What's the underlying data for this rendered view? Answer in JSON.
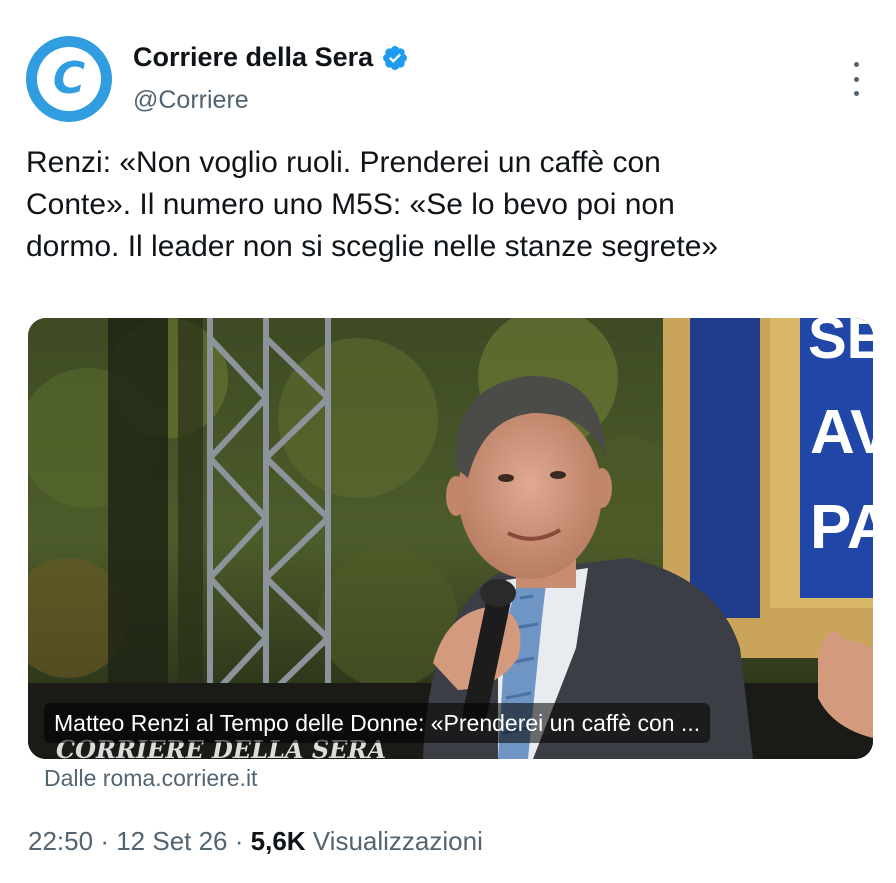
{
  "tweet": {
    "display_name": "Corriere della Sera",
    "handle": "@Corriere",
    "avatar_letter": "C",
    "verified_icon": "verified-badge-icon",
    "text": "Renzi: «Non voglio ruoli. Prenderei un caffè con\nConte». Il numero uno M5S: «Se lo bevo poi non\ndormo. Il leader non si sceglie nelle stanze segrete»",
    "link_card": {
      "caption": "Matteo Renzi al Tempo delle Donne: «Prenderei un caffè con ...",
      "image_overlay_text": "CORRIERE DELLA SERA",
      "banner_text": [
        "SE",
        "AV",
        "PA"
      ],
      "source": "Dalle roma.corriere.it"
    },
    "time": "22:50",
    "date": "12 Set 26",
    "views_count": "5,6K",
    "views_label": "Visualizzazioni"
  },
  "colors": {
    "accent": "#2f9de0",
    "verified": "#1d9bf0",
    "text_primary": "#0f1419",
    "text_secondary": "#536471"
  }
}
